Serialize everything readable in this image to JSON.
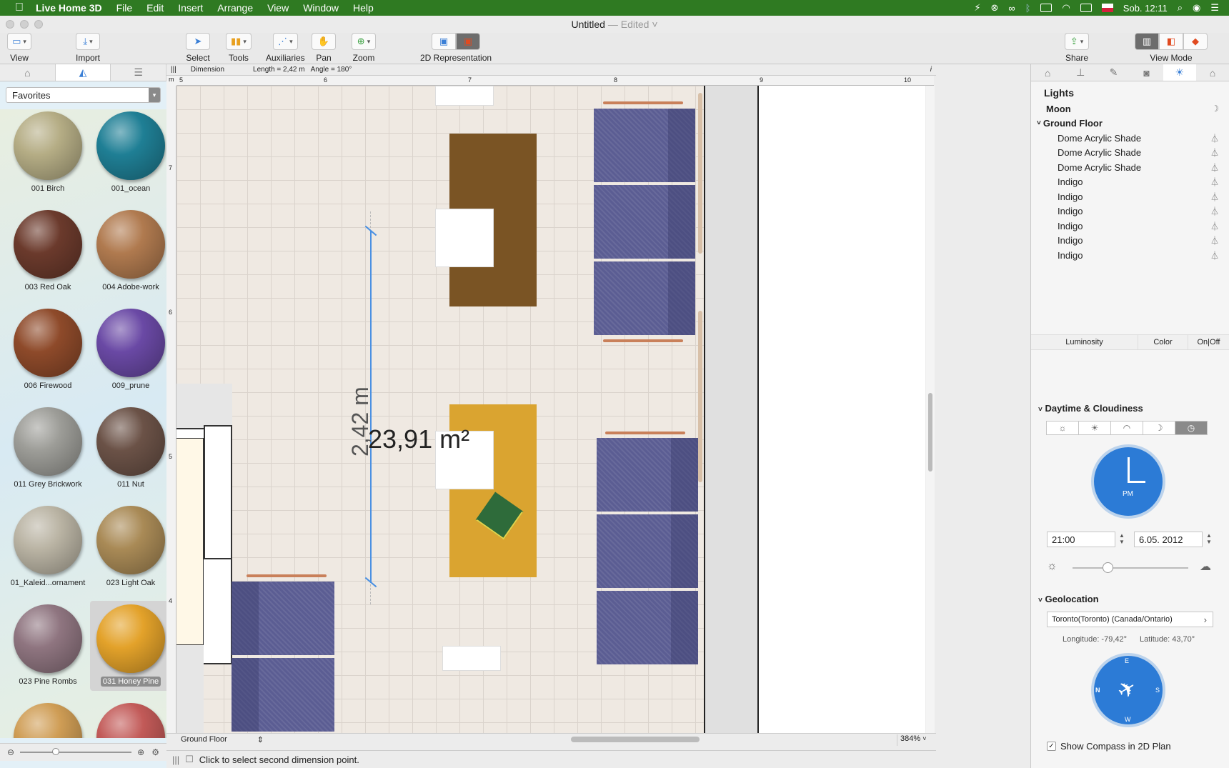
{
  "menubar": {
    "app_name": "Live Home 3D",
    "items": [
      "File",
      "Edit",
      "Insert",
      "Arrange",
      "View",
      "Window",
      "Help"
    ],
    "clock": "Sob. 12:11"
  },
  "window": {
    "title": "Untitled",
    "edited": "— Edited ˅"
  },
  "toolbar": {
    "view": "View",
    "import": "Import",
    "select": "Select",
    "tools": "Tools",
    "auxiliaries": "Auxiliaries",
    "pan": "Pan",
    "zoom": "Zoom",
    "representation": "2D Representation",
    "share": "Share",
    "view_mode": "View Mode"
  },
  "library": {
    "category": "Favorites",
    "materials": [
      {
        "name": "001 Birch",
        "color": "#b5ad85"
      },
      {
        "name": "001_ocean",
        "color": "#1f7f95"
      },
      {
        "name": "003 Red Oak",
        "color": "#6b3a2c"
      },
      {
        "name": "004 Adobe-work",
        "color": "#b07a4f"
      },
      {
        "name": "006 Firewood",
        "color": "#8e4a2a"
      },
      {
        "name": "009_prune",
        "color": "#6a49a5"
      },
      {
        "name": "011 Grey Brickwork",
        "color": "#9d9d98"
      },
      {
        "name": "011 Nut",
        "color": "#6b5247"
      },
      {
        "name": "01_Kaleid...ornament",
        "color": "#bab4a4"
      },
      {
        "name": "023 Light Oak",
        "color": "#a98a56"
      },
      {
        "name": "023 Pine Rombs",
        "color": "#8f7580"
      },
      {
        "name": "031 Honey Pine",
        "color": "#e3a22a"
      },
      {
        "name": "",
        "color": "#cf9d55"
      },
      {
        "name": "",
        "color": "#c25a58"
      }
    ]
  },
  "dimension": {
    "mode": "Dimension",
    "length": "Length = 2,42 m",
    "angle": "Angle = 180°",
    "info_icon": "i"
  },
  "ruler": {
    "unit": "m",
    "h_ticks": [
      "5",
      "6",
      "7",
      "8",
      "9",
      "10"
    ],
    "v_ticks": [
      "7",
      "6",
      "5",
      "4"
    ]
  },
  "plan": {
    "dimension_label": "2,42 m",
    "area_label": "23,91 m²",
    "floor": "Ground Floor",
    "zoom": "384%"
  },
  "status": {
    "message": "Click to select second dimension point."
  },
  "lights": {
    "title": "Lights",
    "moon": "Moon",
    "group": "Ground Floor",
    "items": [
      "Dome Acrylic Shade",
      "Dome Acrylic Shade",
      "Dome Acrylic Shade",
      "Indigo",
      "Indigo",
      "Indigo",
      "Indigo",
      "Indigo",
      "Indigo"
    ],
    "columns": [
      "Luminosity",
      "Color",
      "On|Off"
    ]
  },
  "daytime": {
    "title": "Daytime & Cloudiness",
    "clock_period": "PM",
    "time": "21:00",
    "date": "6.05. 2012",
    "cloudiness": 0.3
  },
  "geolocation": {
    "title": "Geolocation",
    "location": "Toronto(Toronto) (Canada/Ontario)",
    "longitude": "Longitude: -79,42°",
    "latitude": "Latitude: 43,70°",
    "compass": [
      "N",
      "E",
      "S",
      "W"
    ],
    "show_compass": "Show Compass in 2D Plan",
    "show_compass_checked": true
  }
}
